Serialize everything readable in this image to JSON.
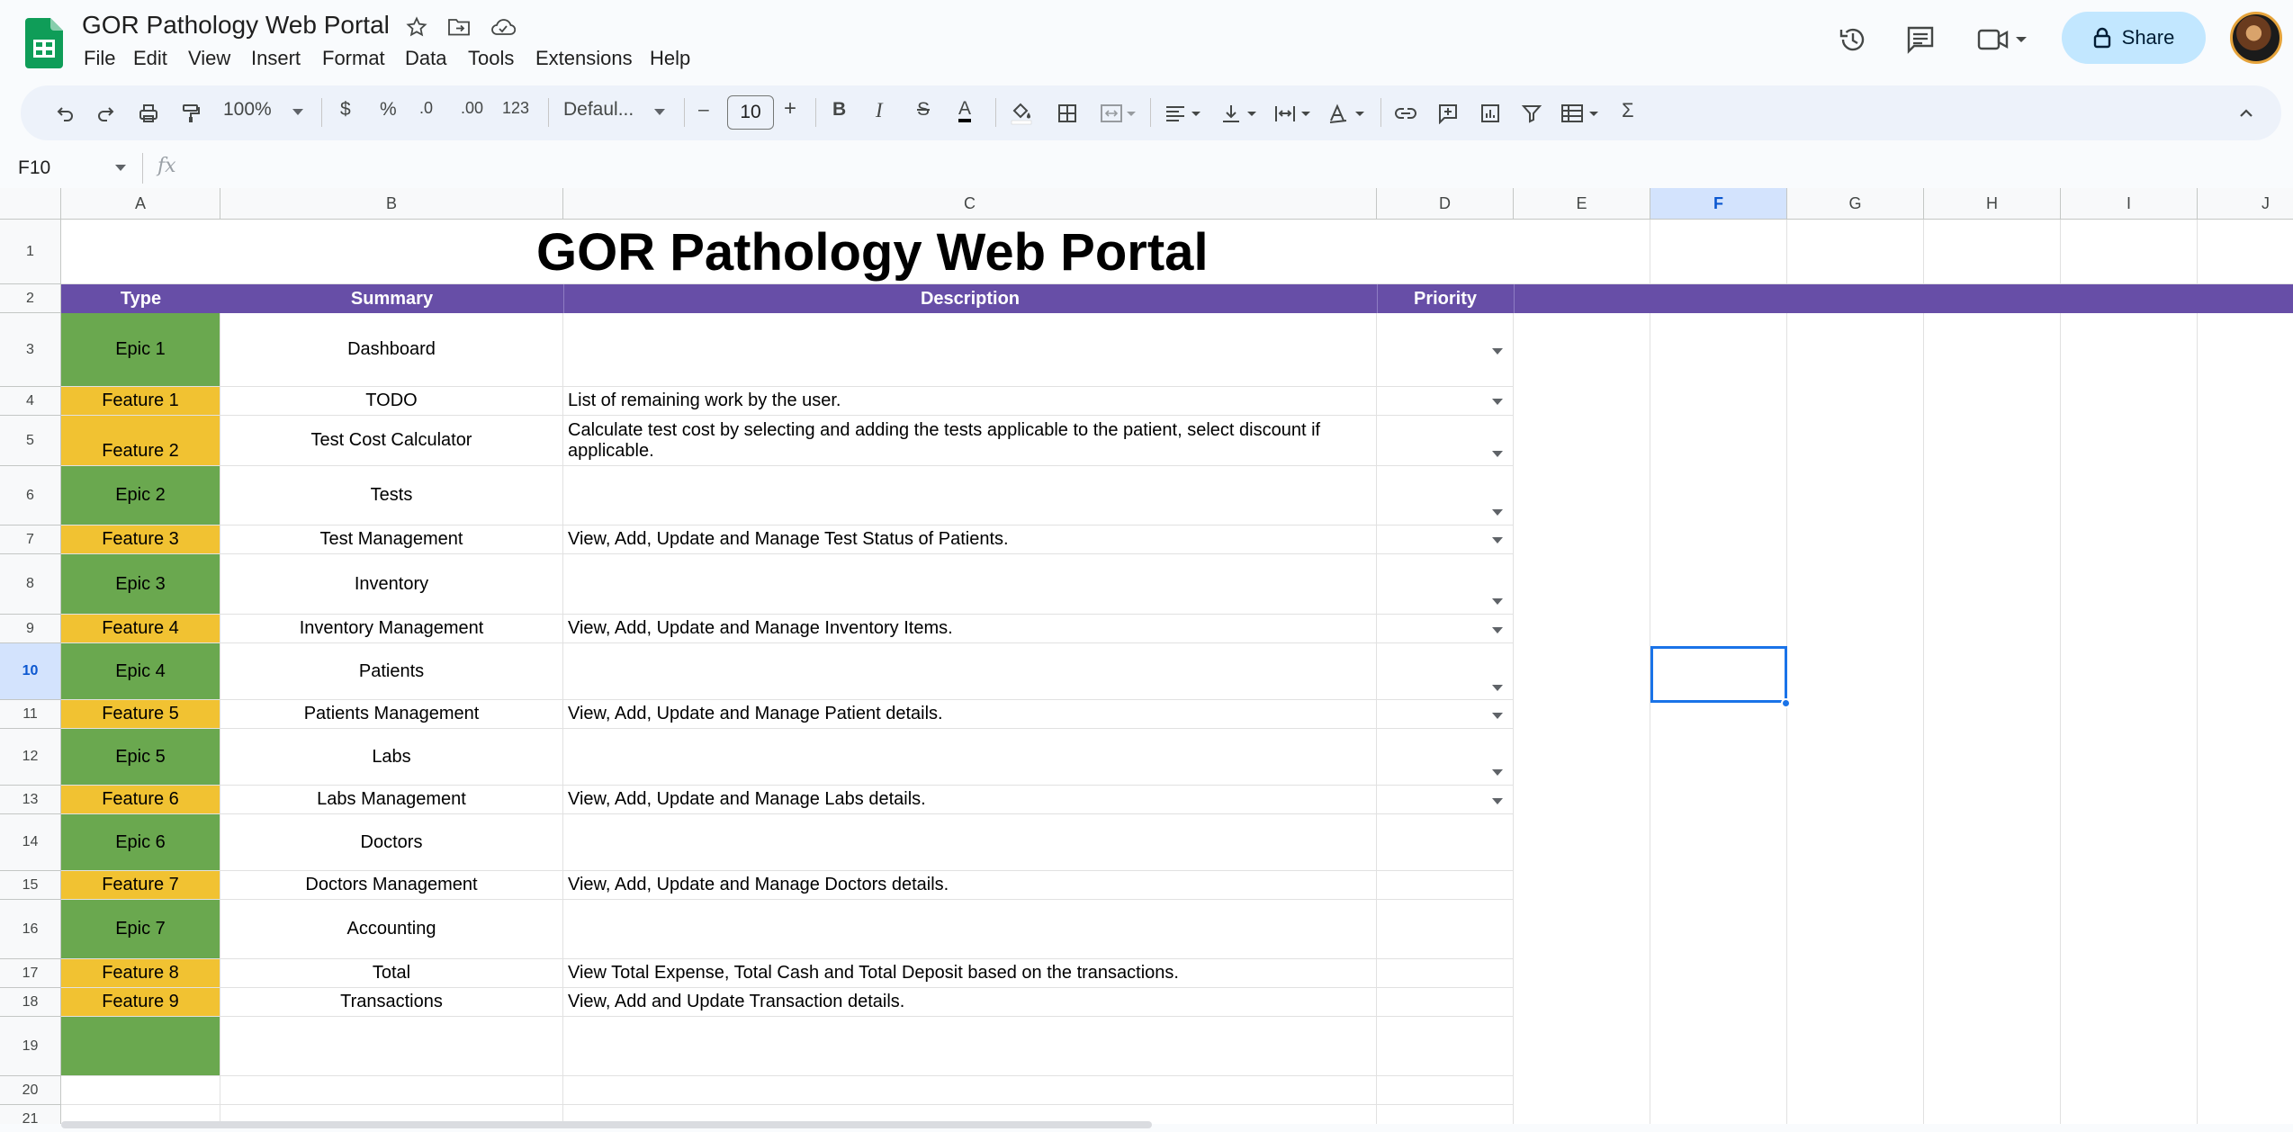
{
  "app": {
    "doc_title": "GOR Pathology Web Portal",
    "menu": [
      "File",
      "Edit",
      "View",
      "Insert",
      "Format",
      "Data",
      "Tools",
      "Extensions",
      "Help"
    ],
    "share_label": "Share"
  },
  "toolbar": {
    "zoom": "100%",
    "currency": "$",
    "percent": "%",
    "dec_decrease": ".0",
    "dec_increase": ".00",
    "number_format": "123",
    "font": "Defaul...",
    "font_size": "10",
    "minus": "–",
    "plus": "+",
    "bold": "B",
    "italic": "I",
    "strike": "S",
    "text_color_letter": "A",
    "sum": "Σ"
  },
  "formula_bar": {
    "name_box": "F10",
    "fx": "fx"
  },
  "columns": [
    "A",
    "B",
    "C",
    "D",
    "E",
    "F",
    "G",
    "H",
    "I",
    "J"
  ],
  "selected_column": "F",
  "selected_row": "10",
  "rows": [
    "1",
    "2",
    "3",
    "4",
    "5",
    "6",
    "7",
    "8",
    "9",
    "10",
    "11",
    "12",
    "13",
    "14",
    "15",
    "16",
    "17",
    "18",
    "19",
    "20",
    "21"
  ],
  "sheet": {
    "title": "GOR Pathology Web Portal",
    "headers": {
      "type": "Type",
      "summary": "Summary",
      "description": "Description",
      "priority": "Priority"
    },
    "items": [
      {
        "row": "3",
        "type": "Epic 1",
        "kind": "epic",
        "summary": "Dashboard",
        "description": ""
      },
      {
        "row": "4",
        "type": "Feature 1",
        "kind": "feature",
        "summary": "TODO",
        "description": "List of remaining work by the user."
      },
      {
        "row": "5",
        "type": "Feature 2",
        "kind": "feature",
        "summary": "Test Cost Calculator",
        "description": "Calculate test cost by selecting and adding the tests applicable to the patient, select discount if applicable."
      },
      {
        "row": "6",
        "type": "Epic 2",
        "kind": "epic",
        "summary": "Tests",
        "description": ""
      },
      {
        "row": "7",
        "type": "Feature 3",
        "kind": "feature",
        "summary": "Test Management",
        "description": "View, Add, Update and Manage Test Status of Patients."
      },
      {
        "row": "8",
        "type": "Epic 3",
        "kind": "epic",
        "summary": "Inventory",
        "description": ""
      },
      {
        "row": "9",
        "type": "Feature 4",
        "kind": "feature",
        "summary": "Inventory Management",
        "description": "View, Add, Update and Manage Inventory Items."
      },
      {
        "row": "10",
        "type": "Epic 4",
        "kind": "epic",
        "summary": "Patients",
        "description": ""
      },
      {
        "row": "11",
        "type": "Feature 5",
        "kind": "feature",
        "summary": "Patients Management",
        "description": "View, Add, Update and Manage Patient details."
      },
      {
        "row": "12",
        "type": "Epic 5",
        "kind": "epic",
        "summary": "Labs",
        "description": ""
      },
      {
        "row": "13",
        "type": "Feature 6",
        "kind": "feature",
        "summary": "Labs Management",
        "description": "View, Add, Update and Manage Labs details."
      },
      {
        "row": "14",
        "type": "Epic 6",
        "kind": "epic",
        "summary": "Doctors",
        "description": ""
      },
      {
        "row": "15",
        "type": "Feature 7",
        "kind": "feature",
        "summary": "Doctors Management",
        "description": "View, Add, Update and Manage Doctors details."
      },
      {
        "row": "16",
        "type": "Epic 7",
        "kind": "epic",
        "summary": "Accounting",
        "description": ""
      },
      {
        "row": "17",
        "type": "Feature 8",
        "kind": "feature",
        "summary": "Total",
        "description": "View Total Expense, Total Cash and Total Deposit based on the transactions."
      },
      {
        "row": "18",
        "type": "Feature 9",
        "kind": "feature",
        "summary": "Transactions",
        "description": "View, Add and Update Transaction details."
      },
      {
        "row": "19",
        "type": "",
        "kind": "epic",
        "summary": "",
        "description": ""
      }
    ]
  },
  "colors": {
    "header_purple": "#674ea7",
    "epic_green": "#6aa84f",
    "feature_yellow": "#f1c232",
    "selection_blue": "#1a73e8",
    "share_bg": "#c2e7ff"
  },
  "icons": [
    "sheets-logo-icon",
    "star-icon",
    "move-folder-icon",
    "cloud-saved-icon",
    "history-icon",
    "comments-icon",
    "meet-video-icon",
    "lock-icon",
    "undo-icon",
    "redo-icon",
    "print-icon",
    "paint-format-icon",
    "fill-color-icon",
    "borders-icon",
    "merge-cells-icon",
    "align-left-icon",
    "valign-bottom-icon",
    "text-wrap-icon",
    "text-rotate-icon",
    "link-icon",
    "comment-add-icon",
    "chart-icon",
    "filter-icon",
    "table-view-icon",
    "collapse-toolbar-icon",
    "dropdown-arrow-icon"
  ]
}
